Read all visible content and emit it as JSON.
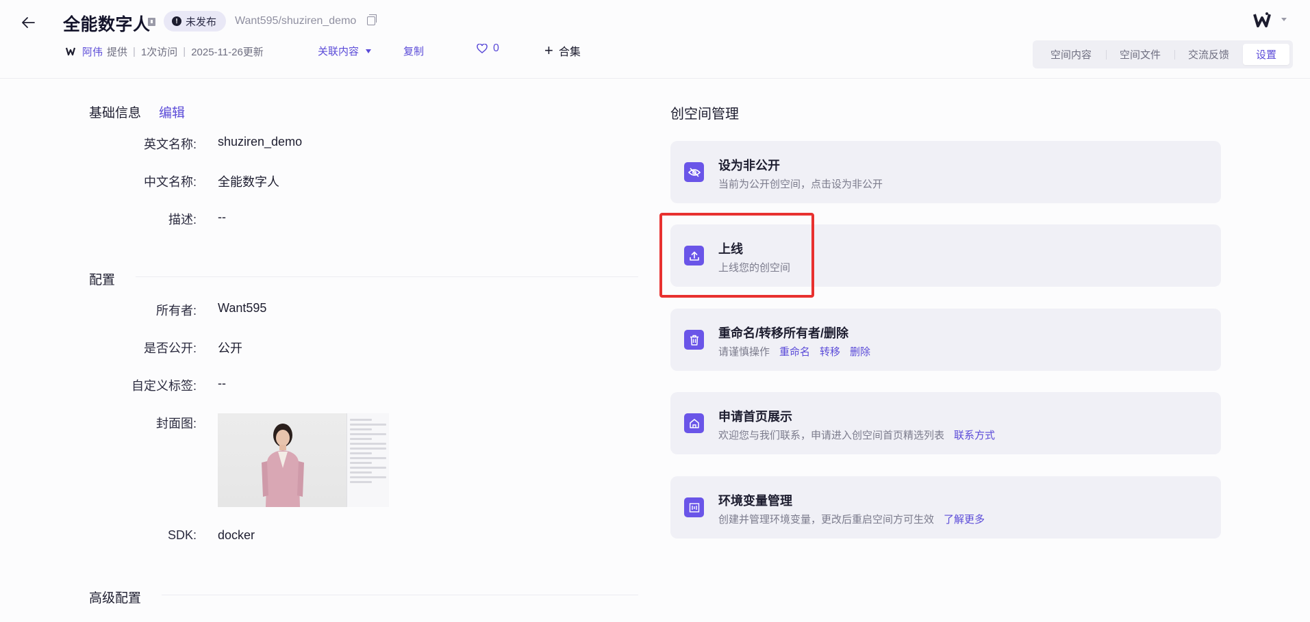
{
  "header": {
    "title": "全能数字人",
    "status": "未发布",
    "repo_path": "Want595/shuziren_demo",
    "provider_name": "阿伟",
    "provided_text": "提供",
    "visits": "1次访问",
    "updated": "2025-11-26更新",
    "associated_label": "关联内容",
    "copy_label": "复制",
    "like_count": "0",
    "collection_label": "合集"
  },
  "tabs": [
    {
      "label": "空间内容",
      "active": false
    },
    {
      "label": "空间文件",
      "active": false
    },
    {
      "label": "交流反馈",
      "active": false
    },
    {
      "label": "设置",
      "active": true
    }
  ],
  "basic": {
    "title": "基础信息",
    "edit_label": "编辑",
    "fields": [
      {
        "label": "英文名称:",
        "value": "shuziren_demo"
      },
      {
        "label": "中文名称:",
        "value": "全能数字人"
      },
      {
        "label": "描述:",
        "value": "--"
      }
    ]
  },
  "config": {
    "title": "配置",
    "fields": [
      {
        "label": "所有者:",
        "value": "Want595"
      },
      {
        "label": "是否公开:",
        "value": "公开"
      },
      {
        "label": "自定义标签:",
        "value": "--"
      },
      {
        "label": "封面图:",
        "value": ""
      },
      {
        "label": "SDK:",
        "value": "docker"
      }
    ]
  },
  "advanced": {
    "title": "高级配置"
  },
  "management": {
    "title": "创空间管理",
    "cards": [
      {
        "title": "设为非公开",
        "desc": "当前为公开创空间，点击设为非公开",
        "icon": "eye-off-icon",
        "links": []
      },
      {
        "title": "上线",
        "desc": "上线您的创空间",
        "icon": "upload-icon",
        "links": []
      },
      {
        "title": "重命名/转移所有者/删除",
        "desc": "请谨慎操作",
        "icon": "trash-icon",
        "links": [
          "重命名",
          "转移",
          "删除"
        ]
      },
      {
        "title": "申请首页展示",
        "desc": "欢迎您与我们联系，申请进入创空间首页精选列表",
        "icon": "home-icon",
        "links": [
          "联系方式"
        ]
      },
      {
        "title": "环境变量管理",
        "desc": "创建并管理环境变量，更改后重启空间方可生效",
        "icon": "env-icon",
        "links": [
          "了解更多"
        ]
      }
    ]
  },
  "colors": {
    "accent": "#5b4bd8",
    "icon_bg": "#6a55e8",
    "highlight": "#e8312f"
  }
}
